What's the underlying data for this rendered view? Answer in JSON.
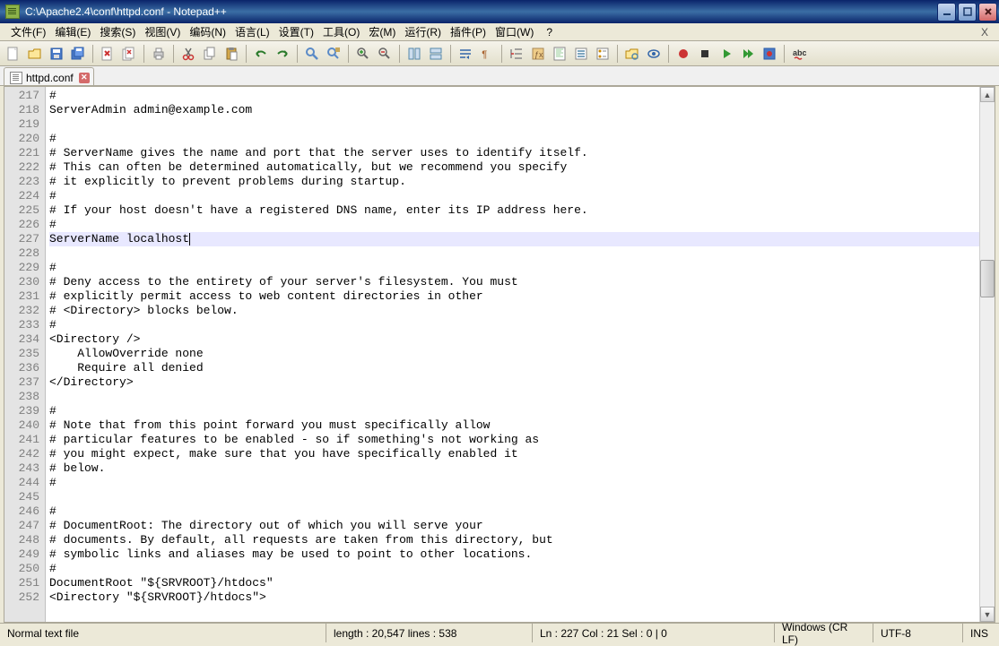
{
  "title": "C:\\Apache2.4\\conf\\httpd.conf - Notepad++",
  "menu": {
    "file": "文件(F)",
    "edit": "编辑(E)",
    "search": "搜索(S)",
    "view": "视图(V)",
    "encoding": "编码(N)",
    "language": "语言(L)",
    "settings": "设置(T)",
    "tools": "工具(O)",
    "macro": "宏(M)",
    "run": "运行(R)",
    "plugins": "插件(P)",
    "window": "窗口(W)",
    "help": "?",
    "x": "X"
  },
  "tab": {
    "name": "httpd.conf"
  },
  "editor": {
    "startLine": 217,
    "currentLine": 227,
    "lines": [
      "#",
      "ServerAdmin admin@example.com",
      "",
      "#",
      "# ServerName gives the name and port that the server uses to identify itself.",
      "# This can often be determined automatically, but we recommend you specify",
      "# it explicitly to prevent problems during startup.",
      "#",
      "# If your host doesn't have a registered DNS name, enter its IP address here.",
      "#",
      "ServerName localhost",
      "",
      "#",
      "# Deny access to the entirety of your server's filesystem. You must",
      "# explicitly permit access to web content directories in other",
      "# <Directory> blocks below.",
      "#",
      "<Directory />",
      "    AllowOverride none",
      "    Require all denied",
      "</Directory>",
      "",
      "#",
      "# Note that from this point forward you must specifically allow",
      "# particular features to be enabled - so if something's not working as",
      "# you might expect, make sure that you have specifically enabled it",
      "# below.",
      "#",
      "",
      "#",
      "# DocumentRoot: The directory out of which you will serve your",
      "# documents. By default, all requests are taken from this directory, but",
      "# symbolic links and aliases may be used to point to other locations.",
      "#",
      "DocumentRoot \"${SRVROOT}/htdocs\"",
      "<Directory \"${SRVROOT}/htdocs\">"
    ]
  },
  "status": {
    "filetype": "Normal text file",
    "length": "length : 20,547    lines : 538",
    "pos": "Ln : 227    Col : 21    Sel : 0 | 0",
    "eol": "Windows (CR LF)",
    "enc": "UTF-8",
    "ins": "INS"
  },
  "toolbar_icons": [
    "new-file",
    "open-file",
    "save",
    "save-all",
    "sep",
    "close",
    "close-all",
    "sep",
    "print",
    "sep",
    "cut",
    "copy",
    "paste",
    "sep",
    "undo",
    "redo",
    "sep",
    "find",
    "replace",
    "sep",
    "zoom-in",
    "zoom-out",
    "sep",
    "sync-v",
    "sync-h",
    "sep",
    "word-wrap",
    "show-all",
    "sep",
    "indent-guide",
    "user-lang",
    "doc-map",
    "doc-list",
    "func-list",
    "sep",
    "folder-workspace",
    "monitor",
    "sep",
    "record-macro",
    "stop-macro",
    "play-macro",
    "play-multi",
    "save-macro",
    "sep",
    "spell-check"
  ],
  "icon_svg": {
    "new-file": "<rect x='2' y='1' width='10' height='14' fill='#fff' stroke='#999'/><path d='M9 1 L12 4 L9 4 Z' fill='#ddd'/>",
    "open-file": "<path d='M1 5 L6 5 L7 3 L14 3 L14 13 L1 13 Z' fill='#fce79a' stroke='#b8860b'/>",
    "save": "<rect x='2' y='2' width='12' height='12' fill='#4a7ac7' stroke='#2a5aa7'/><rect x='4' y='3' width='8' height='4' fill='#fff'/><rect x='5' y='9' width='6' height='4' fill='#ddd'/>",
    "save-all": "<rect x='1' y='4' width='10' height='10' fill='#4a7ac7' stroke='#2a5aa7'/><rect x='4' y='1' width='10' height='10' fill='#6a9ae7' stroke='#2a5aa7'/><rect x='6' y='2' width='6' height='3' fill='#fff'/>",
    "close": "<rect x='2' y='1' width='10' height='14' fill='#fff' stroke='#999'/><path d='M5 5 L10 10 M10 5 L5 10' stroke='#c33' stroke-width='2'/>",
    "close-all": "<rect x='1' y='3' width='9' height='12' fill='#fff' stroke='#999'/><rect x='4' y='1' width='9' height='12' fill='#fff' stroke='#999'/><path d='M6 4 L10 8 M10 4 L6 8' stroke='#c33' stroke-width='1.5'/>",
    "print": "<rect x='3' y='6' width='10' height='6' fill='#ccc' stroke='#888'/><rect x='5' y='2' width='6' height='4' fill='#fff' stroke='#888'/><rect x='5' y='10' width='6' height='4' fill='#fff' stroke='#888'/>",
    "cut": "<circle cx='5' cy='12' r='2.5' fill='none' stroke='#c33' stroke-width='1.5'/><circle cx='11' cy='12' r='2.5' fill='none' stroke='#c33' stroke-width='1.5'/><path d='M6 10 L11 2 M10 10 L5 2' stroke='#666' stroke-width='1.5'/>",
    "copy": "<rect x='2' y='4' width='8' height='10' fill='#fff' stroke='#888'/><rect x='5' y='1' width='8' height='10' fill='#fff' stroke='#888'/>",
    "paste": "<rect x='3' y='2' width='10' height='12' fill='#d4a84a' stroke='#8a6a2a'/><rect x='5' y='1' width='6' height='3' fill='#888' rx='1'/><rect x='7' y='6' width='7' height='9' fill='#fff' stroke='#888'/>",
    "undo": "<path d='M3 8 Q8 3 13 8' fill='none' stroke='#2a7a2a' stroke-width='2'/><path d='M3 8 L6 5 M3 8 L6 11' stroke='#2a7a2a' stroke-width='2'/>",
    "redo": "<path d='M13 8 Q8 3 3 8' fill='none' stroke='#2a7a2a' stroke-width='2'/><path d='M13 8 L10 5 M13 8 L10 11' stroke='#2a7a2a' stroke-width='2'/>",
    "find": "<circle cx='6' cy='6' r='4' fill='none' stroke='#5a8ac7' stroke-width='2'/><path d='M9 9 L14 14' stroke='#5a8ac7' stroke-width='2.5'/>",
    "replace": "<circle cx='6' cy='6' r='4' fill='none' stroke='#5a8ac7' stroke-width='2'/><path d='M9 9 L13 13' stroke='#5a8ac7' stroke-width='2'/><rect x='10' y='1' width='5' height='5' fill='#c7a75a'/>",
    "zoom-in": "<circle cx='6' cy='6' r='4' fill='none' stroke='#666' stroke-width='1.5'/><path d='M9 9 L13 13' stroke='#666' stroke-width='2'/><path d='M6 4 L6 8 M4 6 L8 6' stroke='#393' stroke-width='1.5'/>",
    "zoom-out": "<circle cx='6' cy='6' r='4' fill='none' stroke='#666' stroke-width='1.5'/><path d='M9 9 L13 13' stroke='#666' stroke-width='2'/><path d='M4 6 L8 6' stroke='#c33' stroke-width='1.5'/>",
    "sync-v": "<rect x='2' y='2' width='5' height='12' fill='#cde' stroke='#58a'/><rect x='9' y='2' width='5' height='12' fill='#cde' stroke='#58a'/>",
    "sync-h": "<rect x='2' y='2' width='12' height='5' fill='#cde' stroke='#58a'/><rect x='2' y='9' width='12' height='5' fill='#cde' stroke='#58a'/>",
    "word-wrap": "<path d='M2 4 L14 4 M2 8 L14 8 M2 12 L8 12' stroke='#36a' stroke-width='1.5'/><path d='M12 10 L12 14 L9 12 Z' fill='#36a'/>",
    "show-all": "<text x='2' y='12' font-size='11' fill='#a63' font-family='monospace'>¶</text>",
    "indent-guide": "<path d='M2 3 L2 13 M6 3 L14 3 M6 8 L14 8 M6 13 L14 13' stroke='#888' stroke-width='1.5'/><path d='M2 8 L5 8' stroke='#c33' stroke-width='1.5'/>",
    "user-lang": "<rect x='2' y='2' width='12' height='12' fill='#ec8' stroke='#a85'/><text x='4' y='12' font-size='9' fill='#753'>ƒx</text>",
    "doc-map": "<rect x='2' y='1' width='12' height='14' fill='#fff' stroke='#888'/><path d='M4 3 L12 3 M4 5 L10 5 M4 7 L12 7 M4 9 L9 9 M4 11 L12 11' stroke='#9c9' stroke-width='1'/>",
    "doc-list": "<rect x='2' y='2' width='12' height='12' fill='#fff' stroke='#888'/><path d='M4 5 L12 5 M4 8 L12 8 M4 11 L12 11' stroke='#58a' stroke-width='1.5'/>",
    "func-list": "<rect x='2' y='2' width='12' height='12' fill='#fff' stroke='#888'/><circle cx='5' cy='5' r='1.5' fill='#c80'/><circle cx='5' cy='11' r='1.5' fill='#c80'/><path d='M8 5 L12 5 M8 11 L12 11' stroke='#888'/>",
    "folder-workspace": "<path d='M1 5 L5 5 L6 3 L14 3 L14 13 L1 13 Z' fill='#fce79a' stroke='#b8860b'/><circle cx='11' cy='11' r='3' fill='none' stroke='#58a' stroke-width='1.5'/>",
    "monitor": "<ellipse cx='8' cy='8' rx='6' ry='4' fill='none' stroke='#36a' stroke-width='1.5'/><circle cx='8' cy='8' r='2' fill='#36a'/>",
    "record-macro": "<circle cx='8' cy='8' r='5' fill='#c33'/>",
    "stop-macro": "<rect x='4' y='4' width='8' height='8' fill='#333'/>",
    "play-macro": "<path d='M5 3 L13 8 L5 13 Z' fill='#393'/>",
    "play-multi": "<path d='M3 3 L9 8 L3 13 Z' fill='#393'/><path d='M8 3 L14 8 L8 13 Z' fill='#393'/>",
    "save-macro": "<rect x='2' y='2' width='12' height='12' fill='#4a7ac7' stroke='#2a5aa7'/><circle cx='8' cy='8' r='3' fill='#c33'/>",
    "spell-check": "<text x='1' y='10' font-size='9' fill='#333' font-weight='bold'>abc</text><path d='M3 13 Q5 11 7 13 Q9 15 11 13' stroke='#c33' stroke-width='1.5' fill='none'/>"
  }
}
